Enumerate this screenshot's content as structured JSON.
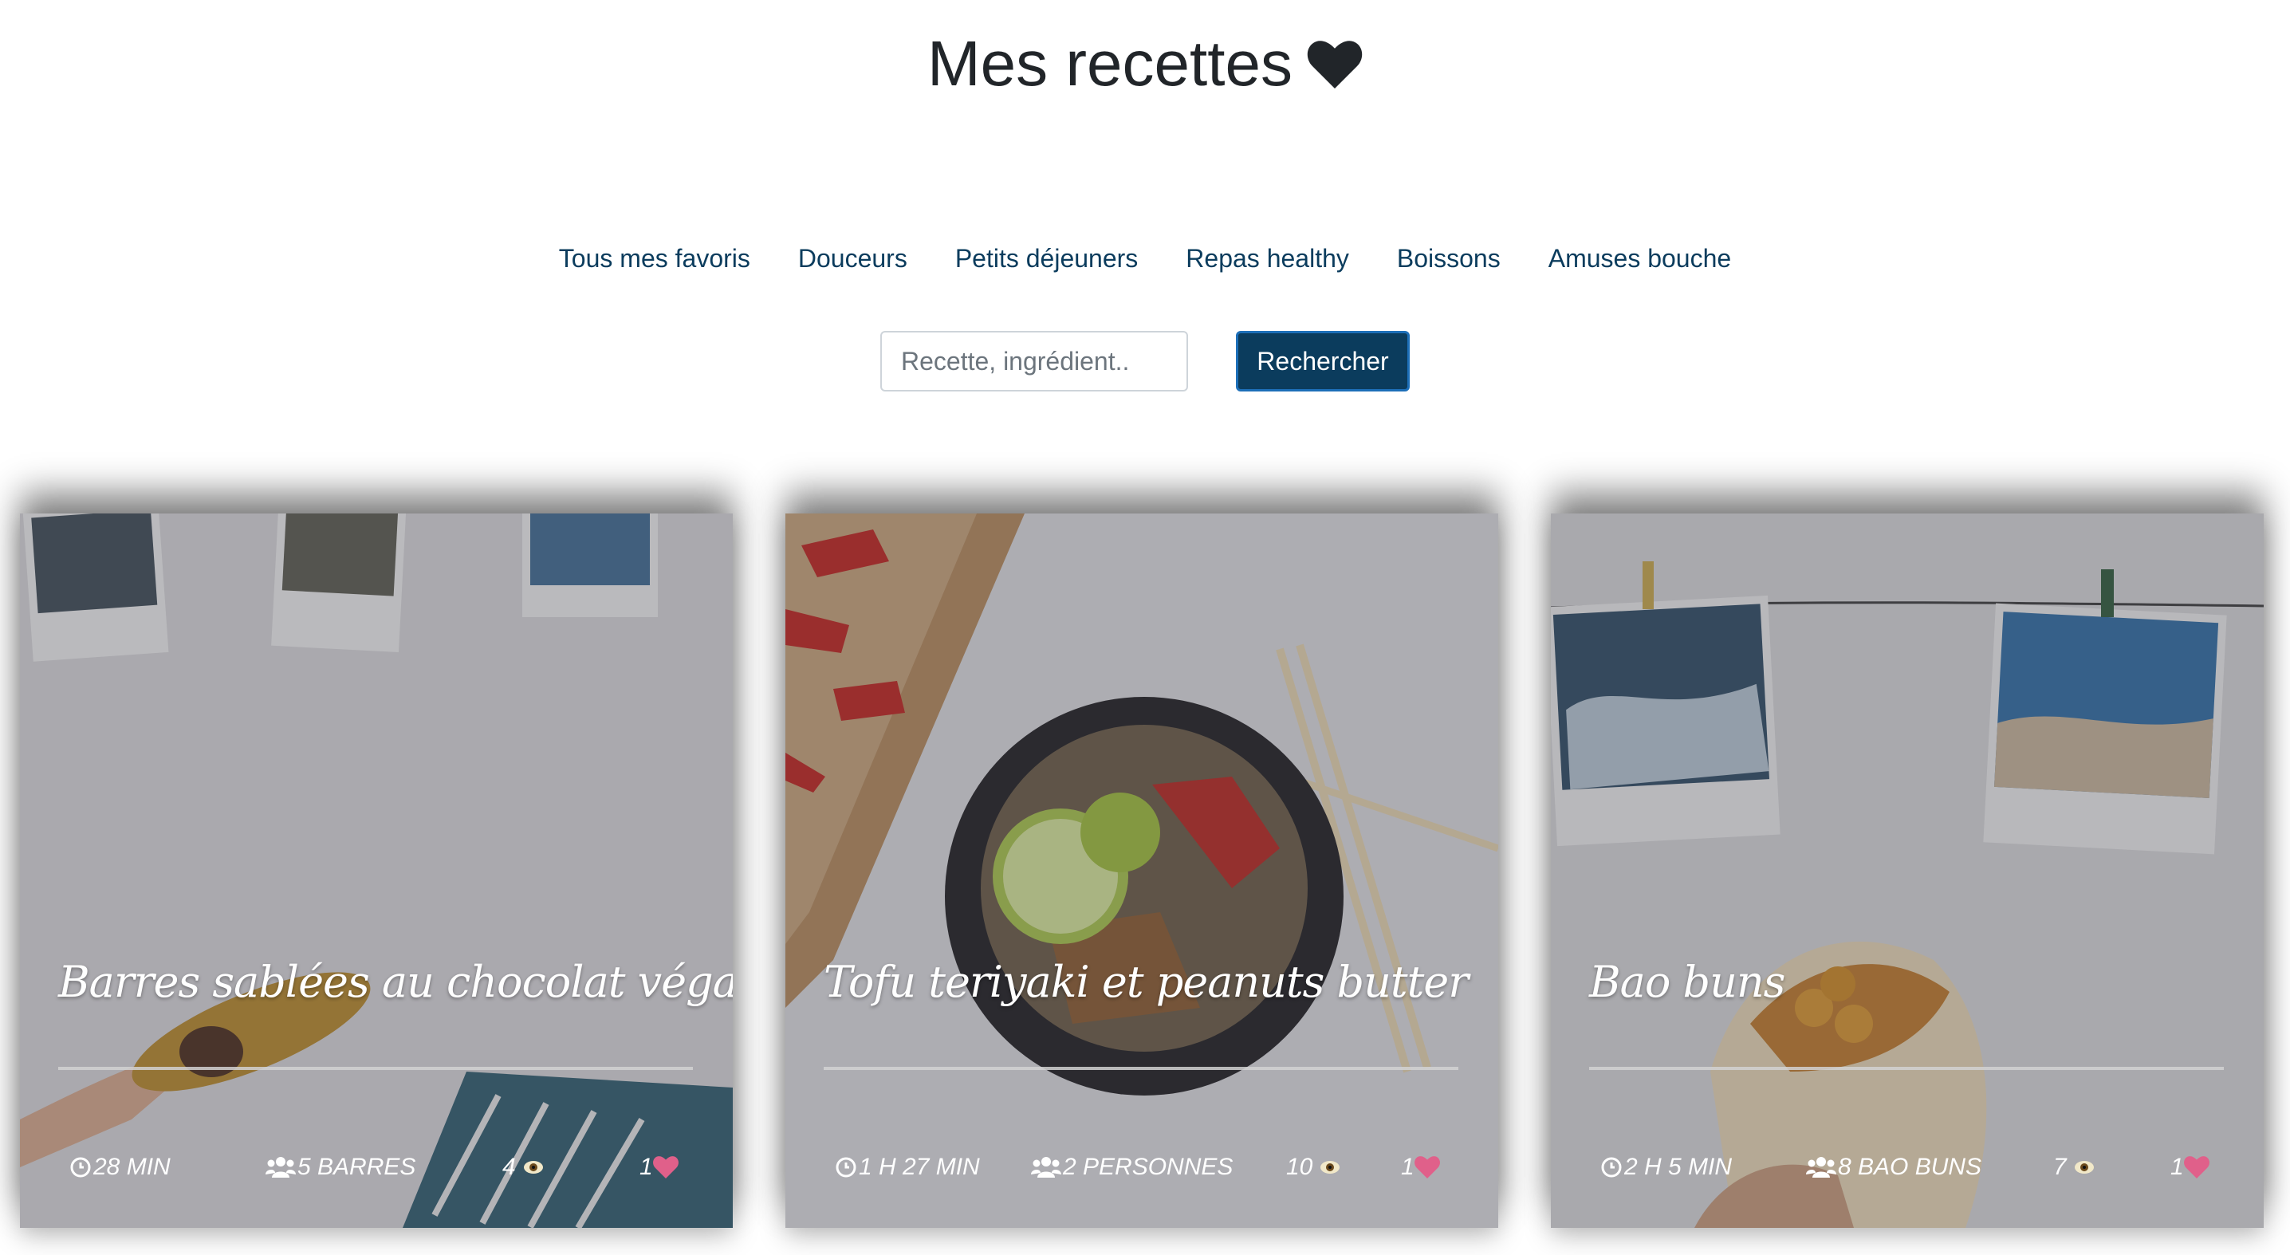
{
  "header": {
    "title": "Mes recettes"
  },
  "nav": {
    "items": [
      "Tous mes favoris",
      "Douceurs",
      "Petits déjeuners",
      "Repas healthy",
      "Boissons",
      "Amuses bouche"
    ]
  },
  "search": {
    "placeholder": "Recette, ingrédient..",
    "button_label": "Rechercher"
  },
  "colors": {
    "accent": "#0b3c5d",
    "heart_pink": "#e0608a"
  },
  "recipes": [
    {
      "title": "Barres sablées au chocolat végan",
      "time": "28 MIN",
      "servings": "5 BARRES",
      "views": "4",
      "likes": "1"
    },
    {
      "title": "Tofu teriyaki et peanuts butter",
      "time": "1 H 27 MIN",
      "servings": "2 PERSONNES",
      "views": "10",
      "likes": "1"
    },
    {
      "title": "Bao buns",
      "time": "2 H 5 MIN",
      "servings": "8 BAO BUNS",
      "views": "7",
      "likes": "1"
    }
  ]
}
